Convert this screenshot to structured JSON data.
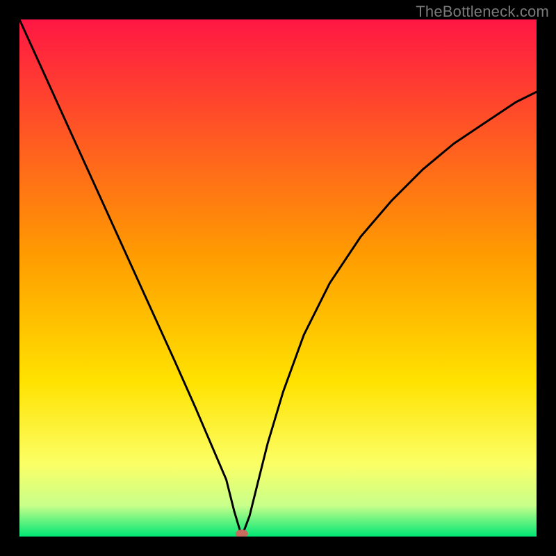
{
  "watermark": "TheBottleneck.com",
  "chart_data": {
    "type": "line",
    "title": "",
    "xlabel": "",
    "ylabel": "",
    "xlim": [
      0,
      100
    ],
    "ylim": [
      0,
      100
    ],
    "grid": false,
    "legend": false,
    "background_gradient_top": "#ff1744",
    "background_gradient_mid": "#ffd600",
    "background_gradient_bottom": "#00e676",
    "marker": {
      "x": 43,
      "y": 0,
      "color": "#c96a5f"
    },
    "series": [
      {
        "name": "bottleneck-curve",
        "color": "#000000",
        "x": [
          0,
          5,
          10,
          15,
          20,
          25,
          30,
          34,
          37,
          40,
          41.5,
          43,
          44.5,
          46,
          48,
          51,
          55,
          60,
          66,
          72,
          78,
          84,
          90,
          96,
          100
        ],
        "values": [
          100,
          89,
          78,
          67,
          56,
          45,
          34,
          25,
          18,
          11,
          5,
          0,
          4,
          10,
          18,
          28,
          39,
          49,
          58,
          65,
          71,
          76,
          80,
          84,
          86
        ]
      }
    ]
  }
}
